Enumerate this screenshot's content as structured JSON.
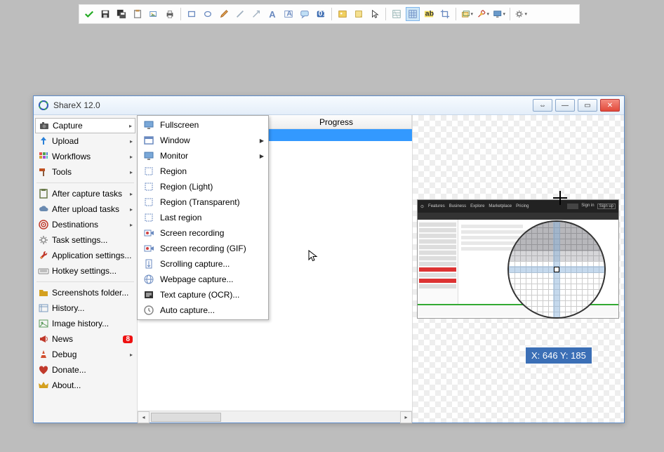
{
  "window": {
    "title": "ShareX 12.0"
  },
  "sidebar": {
    "items": [
      {
        "label": "Capture",
        "icon": "camera",
        "arrow": true,
        "sel": true
      },
      {
        "label": "Upload",
        "icon": "upload-arrow",
        "arrow": true,
        "color": "#2a80d8"
      },
      {
        "label": "Workflows",
        "icon": "grid",
        "arrow": true
      },
      {
        "label": "Tools",
        "icon": "hammer",
        "arrow": true,
        "color": "#c05020"
      }
    ],
    "items2": [
      {
        "label": "After capture tasks",
        "icon": "clipboard",
        "arrow": true,
        "color": "#6a7a4a"
      },
      {
        "label": "After upload tasks",
        "icon": "cloud",
        "arrow": true,
        "color": "#6a8ab0"
      },
      {
        "label": "Destinations",
        "icon": "target",
        "arrow": true,
        "color": "#c0392b"
      },
      {
        "label": "Task settings...",
        "icon": "gear",
        "color": "#888"
      },
      {
        "label": "Application settings...",
        "icon": "wrench",
        "color": "#c0392b"
      },
      {
        "label": "Hotkey settings...",
        "icon": "keyboard",
        "color": "#888"
      }
    ],
    "items3": [
      {
        "label": "Screenshots folder...",
        "icon": "folder",
        "color": "#d4a020"
      },
      {
        "label": "History...",
        "icon": "history",
        "color": "#7a9ac0"
      },
      {
        "label": "Image history...",
        "icon": "image",
        "color": "#5a9a5a"
      },
      {
        "label": "News",
        "icon": "megaphone",
        "badge": "8",
        "color": "#c0392b"
      },
      {
        "label": "Debug",
        "icon": "cone",
        "arrow": true,
        "color": "#d05030"
      },
      {
        "label": "Donate...",
        "icon": "heart",
        "color": "#c0392b"
      },
      {
        "label": "About...",
        "icon": "crown",
        "color": "#d4a020"
      }
    ]
  },
  "submenu": {
    "items": [
      {
        "label": "Fullscreen",
        "icon": "monitor"
      },
      {
        "label": "Window",
        "icon": "window",
        "arrow": true
      },
      {
        "label": "Monitor",
        "icon": "monitor",
        "arrow": true
      },
      {
        "label": "Region",
        "icon": "region"
      },
      {
        "label": "Region (Light)",
        "icon": "region"
      },
      {
        "label": "Region (Transparent)",
        "icon": "region"
      },
      {
        "label": "Last region",
        "icon": "region"
      },
      {
        "label": "Screen recording",
        "icon": "record"
      },
      {
        "label": "Screen recording (GIF)",
        "icon": "record"
      },
      {
        "label": "Scrolling capture...",
        "icon": "scroll"
      },
      {
        "label": "Webpage capture...",
        "icon": "globe"
      },
      {
        "label": "Text capture (OCR)...",
        "icon": "text"
      },
      {
        "label": "Auto capture...",
        "icon": "clock"
      }
    ]
  },
  "list": {
    "col_progress": "Progress"
  },
  "coords": {
    "text": "X: 646 Y: 185"
  },
  "top_toolbar": {
    "icons": [
      "check",
      "save",
      "save-all",
      "clipboard",
      "copy",
      "print",
      "",
      "rect-sel",
      "ellipse-sel",
      "pencil",
      "line",
      "arrow",
      "text-a",
      "text-box",
      "speech",
      "num",
      "",
      "image",
      "note",
      "cursor",
      "",
      "hatch",
      "grid",
      "abc",
      "crop",
      "",
      "layer",
      "tools",
      "monitor",
      "",
      "gear"
    ]
  },
  "preview": {
    "nav": [
      "⊙",
      "Features",
      "Business",
      "Explore",
      "Marketplace",
      "Pricing"
    ],
    "nav_right": [
      "Sign in",
      "Sign up"
    ]
  }
}
